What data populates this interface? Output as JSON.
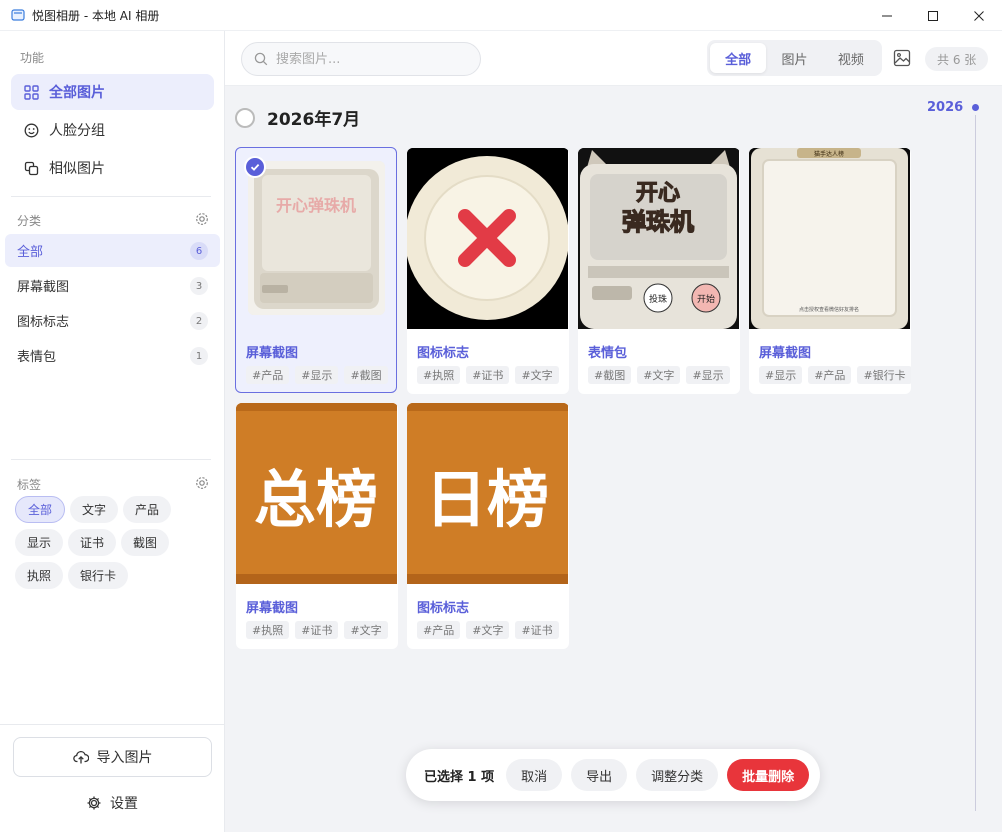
{
  "window": {
    "title": "悦图相册 - 本地 AI 相册"
  },
  "sidebar": {
    "func_title": "功能",
    "nav": [
      {
        "label": "全部图片",
        "icon": "grid-icon",
        "active": true
      },
      {
        "label": "人脸分组",
        "icon": "face-icon",
        "active": false
      },
      {
        "label": "相似图片",
        "icon": "copy-icon",
        "active": false
      }
    ],
    "cat_title": "分类",
    "categories": [
      {
        "label": "全部",
        "count": "6",
        "active": true
      },
      {
        "label": "屏幕截图",
        "count": "3",
        "active": false
      },
      {
        "label": "图标标志",
        "count": "2",
        "active": false
      },
      {
        "label": "表情包",
        "count": "1",
        "active": false
      }
    ],
    "tag_title": "标签",
    "tags": [
      {
        "label": "全部",
        "active": true
      },
      {
        "label": "文字",
        "active": false
      },
      {
        "label": "产品",
        "active": false
      },
      {
        "label": "显示",
        "active": false
      },
      {
        "label": "证书",
        "active": false
      },
      {
        "label": "截图",
        "active": false
      },
      {
        "label": "执照",
        "active": false
      },
      {
        "label": "银行卡",
        "active": false
      }
    ],
    "import_label": "导入图片",
    "settings_label": "设置"
  },
  "toolbar": {
    "search_placeholder": "搜索图片...",
    "filters": [
      "全部",
      "图片",
      "视频"
    ],
    "active_filter": 0,
    "count_label": "共 6 张"
  },
  "group": {
    "title": "2026年7月"
  },
  "timeline": {
    "year": "2026"
  },
  "cards": [
    {
      "title": "屏幕截图",
      "tags": [
        "#产品",
        "#显示",
        "#截图"
      ],
      "selected": true,
      "image": "white-machine"
    },
    {
      "title": "图标标志",
      "tags": [
        "#执照",
        "#证书",
        "#文字"
      ],
      "selected": false,
      "image": "red-x-button"
    },
    {
      "title": "表情包",
      "tags": [
        "#截图",
        "#文字",
        "#显示"
      ],
      "selected": false,
      "image": "pinball-machine"
    },
    {
      "title": "屏幕截图",
      "tags": [
        "#显示",
        "#产品",
        "#银行卡"
      ],
      "selected": false,
      "image": "white-frame"
    },
    {
      "title": "屏幕截图",
      "tags": [
        "#执照",
        "#证书",
        "#文字"
      ],
      "selected": false,
      "image": "orange-banner"
    },
    {
      "title": "图标标志",
      "tags": [
        "#产品",
        "#文字",
        "#证书"
      ],
      "selected": false,
      "image": "orange-banner"
    }
  ],
  "images_text": {
    "card1_logo": "开心弹珠机",
    "card3_logo_line1": "开心",
    "card3_logo_line2": "弹珠机",
    "card3_btn_left": "投珠",
    "card3_btn_right": "开始",
    "card4_top": "猫手达人榜",
    "card4_bottom": "点击授权查看微信好友排名",
    "card5_text": "总榜",
    "card6_text": "日榜"
  },
  "bottombar": {
    "selected_text": "已选择 1 项",
    "cancel": "取消",
    "export": "导出",
    "recategorize": "调整分类",
    "batch_delete": "批量删除"
  },
  "colors": {
    "accent": "#5a5fd9",
    "danger": "#e8353b",
    "banner": "#d17f27"
  }
}
